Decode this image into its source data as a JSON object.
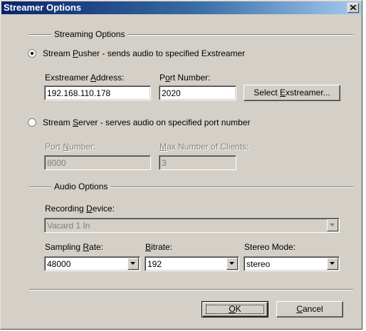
{
  "window": {
    "title": "Streamer Options"
  },
  "streaming_options": {
    "group_label": "Streaming Options",
    "pusher": {
      "radio_label_pre": "Stream ",
      "radio_label_accel": "P",
      "radio_label_post": "usher - sends audio to specified Exstreamer",
      "selected": true,
      "address_label_pre": "Exstreamer ",
      "address_label_accel": "A",
      "address_label_post": "ddress:",
      "address_value": "192.168.110.178",
      "port_label_pre": "P",
      "port_label_accel": "o",
      "port_label_post": "rt Number:",
      "port_value": "2020",
      "select_button_pre": "Select ",
      "select_button_accel": "E",
      "select_button_post": "xstreamer..."
    },
    "server": {
      "radio_label_pre": "Stream ",
      "radio_label_accel": "S",
      "radio_label_post": "erver - serves audio on specified port number",
      "selected": false,
      "port_label_pre": "Port ",
      "port_label_accel": "N",
      "port_label_post": "umber:",
      "port_value": "8000",
      "max_clients_label_pre": "",
      "max_clients_label_accel": "M",
      "max_clients_label_post": "ax Number of Clients:",
      "max_clients_value": "3"
    }
  },
  "audio_options": {
    "group_label": "Audio Options",
    "recording_device_label_pre": "Recording ",
    "recording_device_label_accel": "D",
    "recording_device_label_post": "evice:",
    "recording_device_value": "Vacard 1 In",
    "sampling_rate_label_pre": "Sampling ",
    "sampling_rate_label_accel": "R",
    "sampling_rate_label_post": "ate:",
    "sampling_rate_value": "48000",
    "bitrate_label_pre": "",
    "bitrate_label_accel": "B",
    "bitrate_label_post": "itrate:",
    "bitrate_value": "192",
    "stereo_mode_label": "Stereo Mode:",
    "stereo_mode_value": "stereo"
  },
  "buttons": {
    "ok_accel": "O",
    "ok_post": "K",
    "cancel_accel": "C",
    "cancel_post": "ancel"
  },
  "icons": {
    "close": "close-icon",
    "dropdown": "chevron-down-icon"
  }
}
